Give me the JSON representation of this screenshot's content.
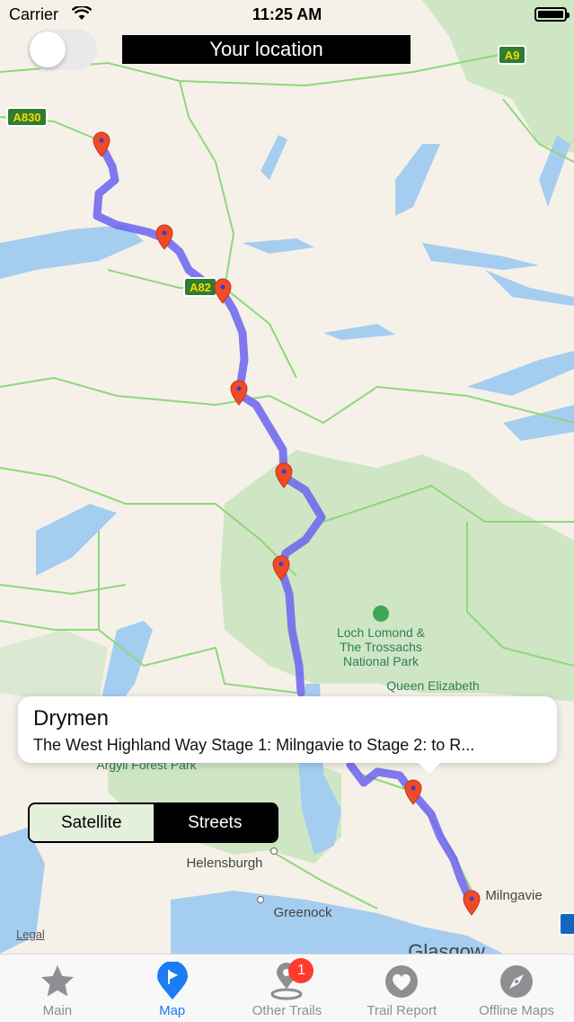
{
  "status_bar": {
    "carrier": "Carrier",
    "time": "11:25 AM"
  },
  "header": {
    "location_label": "Your location",
    "toggle_on": false
  },
  "map": {
    "roads": [
      "A830",
      "A9",
      "A82"
    ],
    "places": [
      {
        "label": "Loch Lomond &\nThe Trossachs\nNational Park"
      },
      {
        "label": "Queen Elizabeth"
      },
      {
        "label": "Argyll Forest Park"
      },
      {
        "label": "Helensburgh"
      },
      {
        "label": "Greenock"
      },
      {
        "label": "Milngavie"
      },
      {
        "label": "Glasgow"
      }
    ],
    "legal": "Legal",
    "route_color": "#6b63f0",
    "pin_color": "#f04a26"
  },
  "callout": {
    "title": "Drymen",
    "subtitle": "The West Highland Way Stage 1: Milngavie to Stage 2: to R..."
  },
  "map_type": {
    "options": [
      "Satellite",
      "Streets"
    ],
    "selected": "Streets"
  },
  "tabs": [
    {
      "label": "Main",
      "icon": "star-icon",
      "active": false
    },
    {
      "label": "Map",
      "icon": "map-pin-icon",
      "active": true
    },
    {
      "label": "Other Trails",
      "icon": "trail-pin-icon",
      "active": false,
      "badge": "1"
    },
    {
      "label": "Trail Report",
      "icon": "heart-icon",
      "active": false
    },
    {
      "label": "Offline Maps",
      "icon": "compass-icon",
      "active": false
    }
  ]
}
